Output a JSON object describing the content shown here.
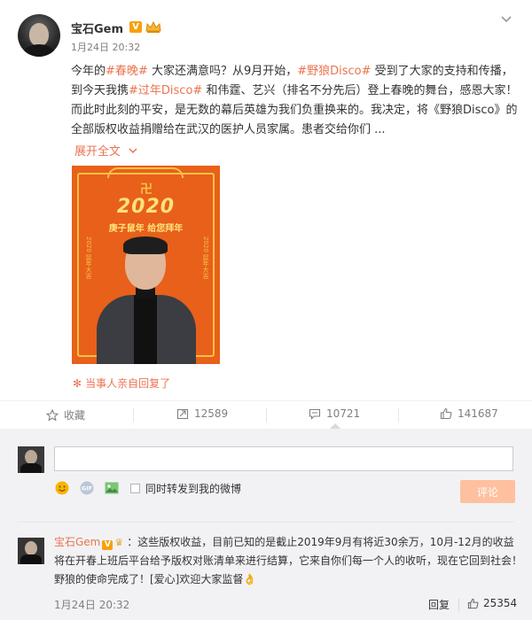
{
  "post": {
    "username": "宝石Gem",
    "verified_badge": "V",
    "time": "1月24日 20:32",
    "content_parts": [
      {
        "type": "text",
        "value": "今年的"
      },
      {
        "type": "tag",
        "value": "#春晚#"
      },
      {
        "type": "text",
        "value": " 大家还满意吗？从9月开始，"
      },
      {
        "type": "tag",
        "value": "#野狼Disco#"
      },
      {
        "type": "text",
        "value": " 受到了大家的支持和传播，到今天我携"
      },
      {
        "type": "tag",
        "value": "#过年Disco#"
      },
      {
        "type": "text",
        "value": " 和伟霆、艺兴（排名不分先后）登上春晚的舞台，感恩大家！而此时此刻的平安，是无数的幕后英雄为我们负重换来的。我决定，将《野狼Disco》的全部版权收益捐赠给在武汉的医护人员家属。患者交给你们 ..."
      }
    ],
    "expand_label": "展开全文",
    "poster": {
      "year": "2020",
      "greeting": "庚子鼠年 给您拜年",
      "side_left": "2020 鼠年大吉",
      "side_right": "2020 鼠年大吉"
    },
    "owner_reply_note": "当事人亲自回复了",
    "accent_color": "#eb7350"
  },
  "actions": {
    "favorite_label": "收藏",
    "repost_count": "12589",
    "comment_count": "10721",
    "like_count": "141687"
  },
  "composer": {
    "input_value": "",
    "forward_checkbox_label": "同时转发到我的微博",
    "submit_label": "评论",
    "submit_color": "#ffc09f"
  },
  "comments": [
    {
      "username": "宝石Gem",
      "text": "：这些版权收益，目前已知的是截止2019年9月有将近30余万，10月-12月的收益将在开春上班后平台给予版权对账清单来进行结算，它来自你们每一个人的收听，现在它回到社会！野狼的使命完成了！[爱心]欢迎大家监督👌",
      "time": "1月24日 20:32",
      "reply_label": "回复",
      "like_count": "25354"
    }
  ]
}
